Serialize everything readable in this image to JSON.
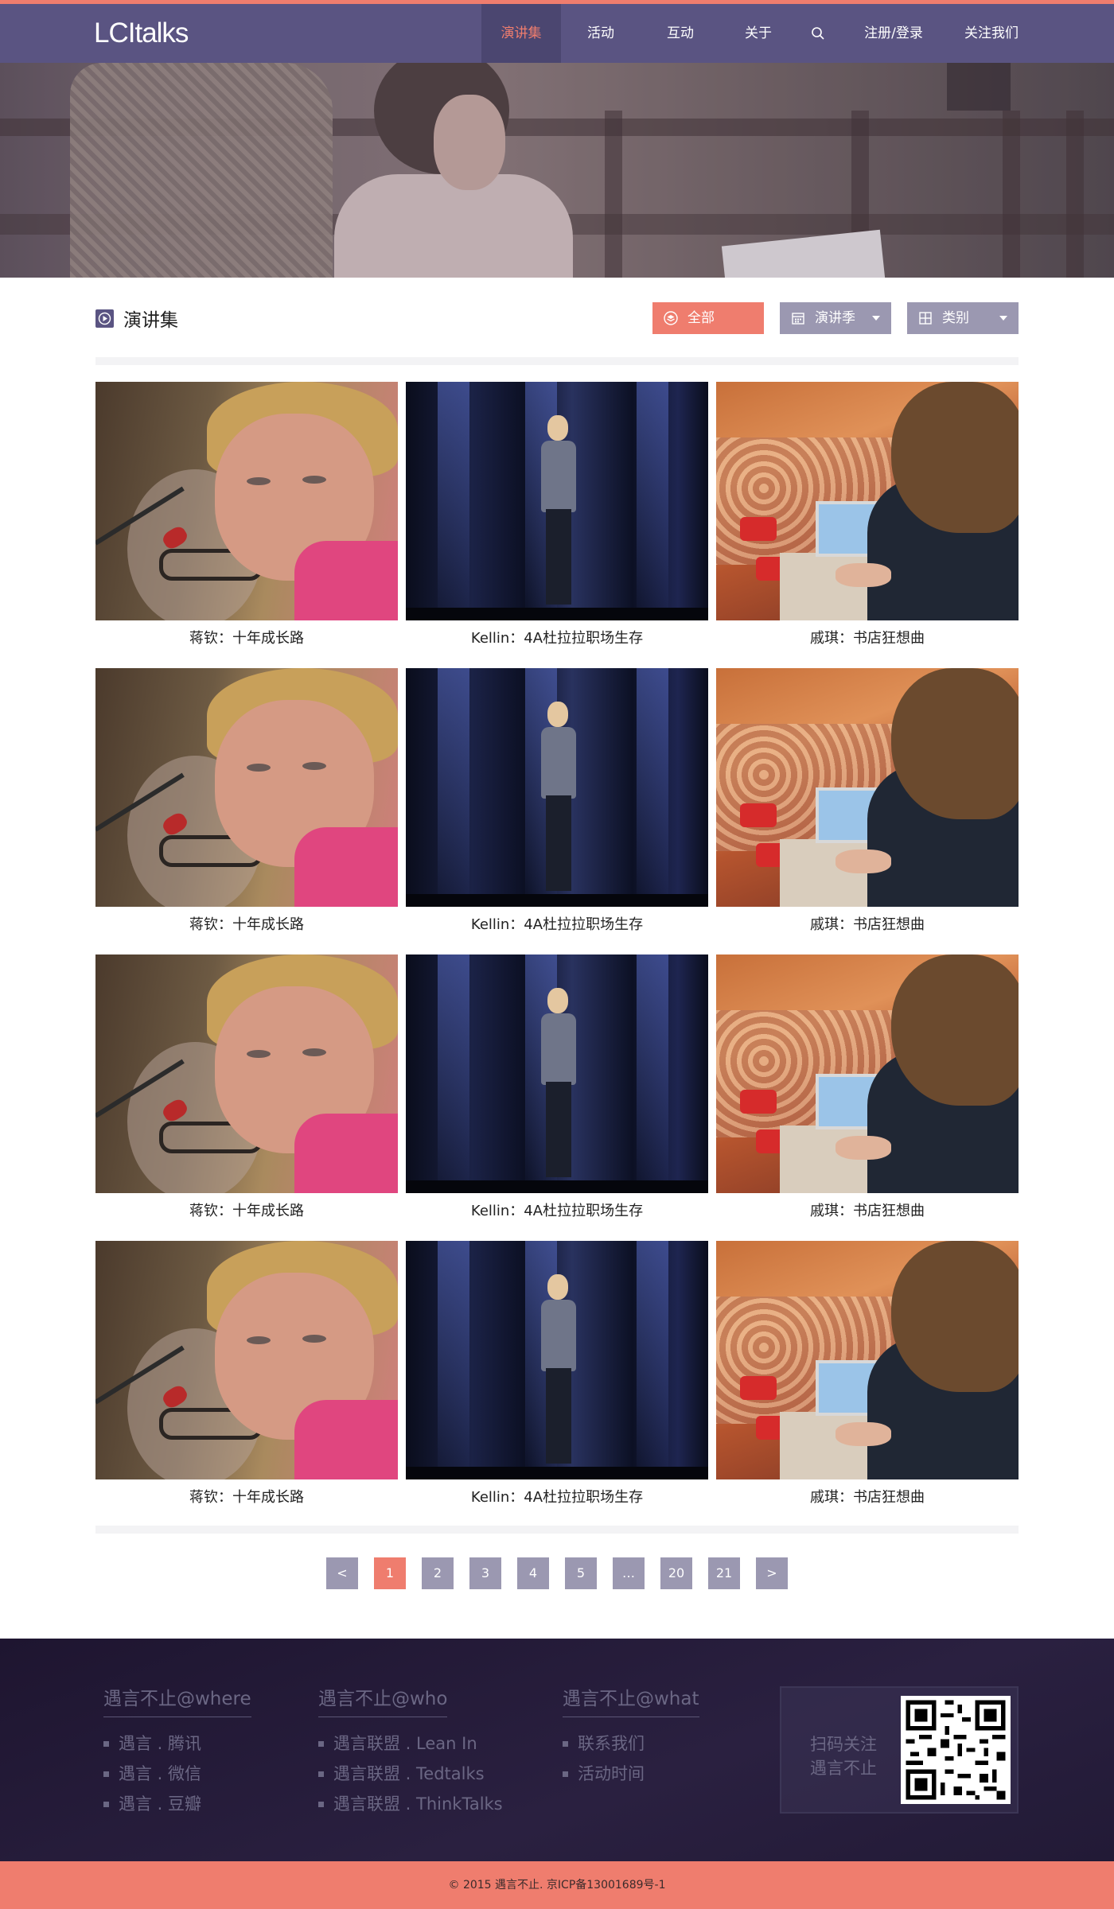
{
  "header": {
    "logo": "LCItalks",
    "nav": [
      {
        "label": "演讲集",
        "active": true
      },
      {
        "label": "活动",
        "active": false
      },
      {
        "label": "互动",
        "active": false
      },
      {
        "label": "关于",
        "active": false
      },
      {
        "label": "search-icon",
        "active": false
      },
      {
        "label": "注册/登录",
        "active": false
      },
      {
        "label": "关注我们",
        "active": false
      }
    ]
  },
  "section": {
    "title": "演讲集",
    "filters": {
      "all": "全部",
      "season": "演讲季",
      "category": "类别"
    }
  },
  "talks": [
    {
      "caption": "蒋钦：十年成长路",
      "image": "thumb-a"
    },
    {
      "caption": "Kellin：4A杜拉拉职场生存",
      "image": "thumb-b"
    },
    {
      "caption": "戚琪：书店狂想曲",
      "image": "thumb-c"
    },
    {
      "caption": "蒋钦：十年成长路",
      "image": "thumb-a"
    },
    {
      "caption": "Kellin：4A杜拉拉职场生存",
      "image": "thumb-b"
    },
    {
      "caption": "戚琪：书店狂想曲",
      "image": "thumb-c"
    },
    {
      "caption": "蒋钦：十年成长路",
      "image": "thumb-a"
    },
    {
      "caption": "Kellin：4A杜拉拉职场生存",
      "image": "thumb-b"
    },
    {
      "caption": "戚琪：书店狂想曲",
      "image": "thumb-c"
    },
    {
      "caption": "蒋钦：十年成长路",
      "image": "thumb-a"
    },
    {
      "caption": "Kellin：4A杜拉拉职场生存",
      "image": "thumb-b"
    },
    {
      "caption": "戚琪：书店狂想曲",
      "image": "thumb-c"
    }
  ],
  "pagination": {
    "pages": [
      "<",
      "1",
      "2",
      "3",
      "4",
      "5",
      "…",
      "20",
      "21",
      ">"
    ],
    "current": "1"
  },
  "footer": {
    "columns": [
      {
        "title": "遇言不止@where",
        "items": [
          "遇言 . 腾讯",
          "遇言 . 微信",
          "遇言 . 豆瓣"
        ]
      },
      {
        "title": "遇言不止@who",
        "items": [
          "遇言联盟 . Lean In",
          "遇言联盟 . Tedtalks",
          "遇言联盟 . ThinkTalks"
        ]
      },
      {
        "title": "遇言不止@what",
        "items": [
          "联系我们",
          "活动时间"
        ]
      }
    ],
    "qr_text_line1": "扫码关注",
    "qr_text_line2": "遇言不止",
    "copyright": "© 2015 遇言不止. 京ICP备13001689号-1"
  },
  "colors": {
    "nav_bg": "#5a5482",
    "accent": "#ef7d6e",
    "filter_gray": "#9b98b1",
    "footer_bg": "#241a36"
  }
}
